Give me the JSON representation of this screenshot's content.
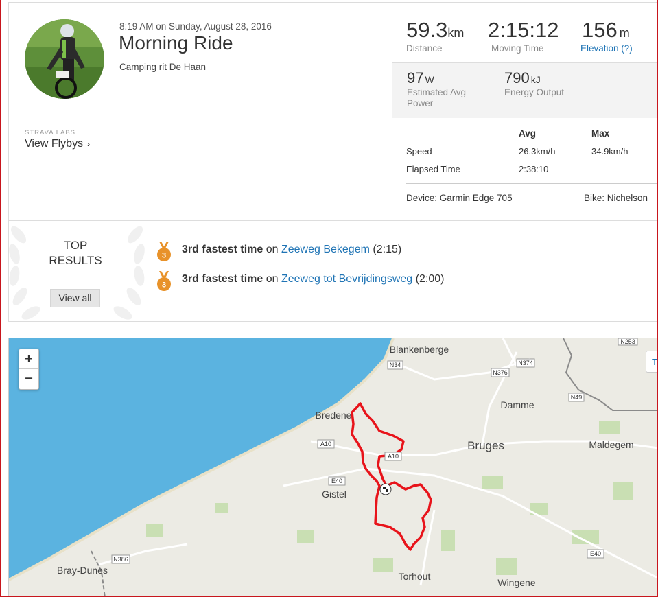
{
  "activity": {
    "time": "8:19 AM on Sunday, August 28, 2016",
    "title": "Morning Ride",
    "subtitle": "Camping rit De Haan"
  },
  "labs": {
    "label": "STRAVA LABS",
    "flybys": "View Flybys"
  },
  "stats": {
    "distance": {
      "value": "59.3",
      "unit": "km",
      "label": "Distance"
    },
    "moving_time": {
      "value": "2:15:12",
      "label": "Moving Time"
    },
    "elevation": {
      "value": "156",
      "unit": "m",
      "label": "Elevation (?)"
    },
    "power": {
      "value": "97",
      "unit": "W",
      "label": "Estimated Avg Power"
    },
    "energy": {
      "value": "790",
      "unit": "kJ",
      "label": "Energy Output"
    }
  },
  "table": {
    "headers": {
      "avg": "Avg",
      "max": "Max"
    },
    "rows": [
      {
        "label": "Speed",
        "avg": "26.3km/h",
        "max": "34.9km/h"
      },
      {
        "label": "Elapsed Time",
        "avg": "2:38:10",
        "max": ""
      }
    ]
  },
  "device": "Device: Garmin Edge 705",
  "bike": "Bike: Nichelson",
  "top_results": {
    "title_line1": "TOP",
    "title_line2": "RESULTS",
    "view_all": "View all",
    "medal_number": "3",
    "items": [
      {
        "rank": "3rd fastest time",
        "on": "on",
        "segment": "Zeeweg Bekegem",
        "time": "(2:15)"
      },
      {
        "rank": "3rd fastest time",
        "on": "on",
        "segment": "Zeeweg tot Bevrijdingsweg",
        "time": "(2:00)"
      }
    ]
  },
  "map": {
    "zoom_in": "+",
    "zoom_out": "−",
    "tab": "Te",
    "places": [
      "Blankenberge",
      "Bredene",
      "Damme",
      "Bruges",
      "Maldegem",
      "Gistel",
      "Bray-Dunes",
      "Torhout",
      "Wingene"
    ],
    "roads": [
      "N34",
      "N374",
      "N376",
      "N49",
      "N253",
      "A10",
      "A10",
      "E40",
      "N386",
      "E40"
    ]
  },
  "colors": {
    "link": "#1f74b5",
    "route": "#e8141b",
    "sea": "#5bb3e0",
    "land": "#ecebe4",
    "medal": "#e8922a"
  }
}
